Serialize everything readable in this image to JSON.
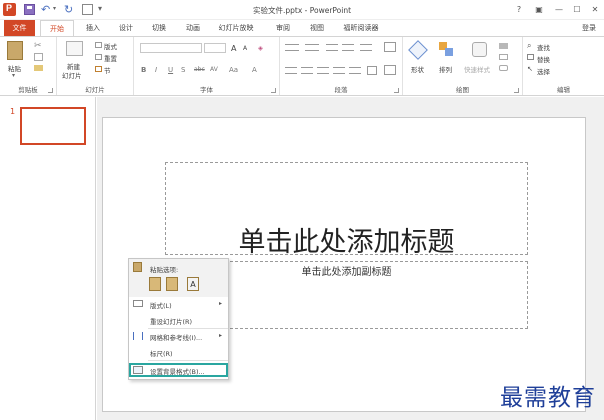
{
  "window": {
    "title": "实验文件.pptx - PowerPoint",
    "help": "?",
    "ribbon_display": "▣",
    "minimize": "—",
    "maximize": "☐",
    "close": "✕"
  },
  "qat": {
    "undo": "↶",
    "redo": "↻",
    "more": "▾"
  },
  "tabs": [
    {
      "label": "文件"
    },
    {
      "label": "开始"
    },
    {
      "label": "插入"
    },
    {
      "label": "设计"
    },
    {
      "label": "切换"
    },
    {
      "label": "动画"
    },
    {
      "label": "幻灯片放映"
    },
    {
      "label": "审阅"
    },
    {
      "label": "视图"
    },
    {
      "label": "福昕阅读器"
    }
  ],
  "login": "登录",
  "ribbon": {
    "clipboard": {
      "paste": "粘贴",
      "label": "剪贴板"
    },
    "slides": {
      "new_slide": "新建",
      "new_slide2": "幻灯片",
      "layout": "版式",
      "reset": "重置",
      "section": "节",
      "label": "幻灯片"
    },
    "font": {
      "grow": "A",
      "shrink": "A",
      "clear": "◈",
      "bold": "B",
      "italic": "I",
      "underline": "U",
      "shadow": "S",
      "strike": "abc",
      "spacing": "AV",
      "case": "Aa",
      "color": "A",
      "label": "字体"
    },
    "paragraph": {
      "label": "段落"
    },
    "drawing": {
      "shapes": "形状",
      "arrange": "排列",
      "quick_styles": "快速样式",
      "label": "绘图"
    },
    "editing": {
      "find": "查找",
      "replace": "替换",
      "select": "选择",
      "label": "编辑"
    }
  },
  "slide_panel": {
    "number": "1"
  },
  "slide": {
    "title": "单击此处添加标题",
    "subtitle": "单击此处添加副标题"
  },
  "context_menu": {
    "paste_options": "粘贴选项:",
    "items": [
      {
        "label": "版式(L)"
      },
      {
        "label": "重设幻灯片(R)"
      },
      {
        "label": "网格和参考线(I)..."
      },
      {
        "label": "标尺(R)"
      },
      {
        "label": "设置背景格式(B)..."
      }
    ]
  },
  "colors": {
    "accent": "#d24726",
    "highlight": "#2aa6a0",
    "watermark": "#1f3f99"
  },
  "watermark": "最需教育"
}
